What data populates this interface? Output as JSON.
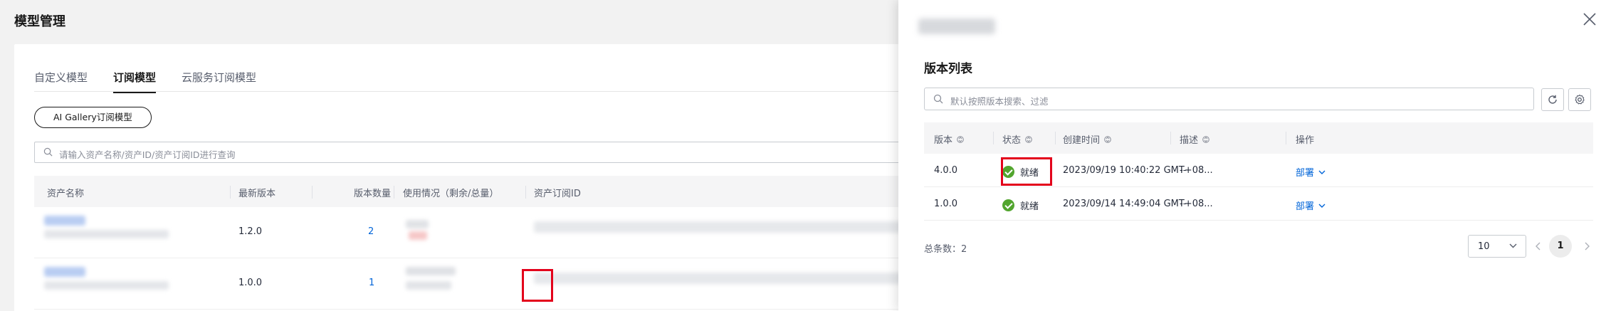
{
  "page": {
    "title": "模型管理"
  },
  "tabs": [
    {
      "label": "自定义模型",
      "active": false
    },
    {
      "label": "订阅模型",
      "active": true
    },
    {
      "label": "云服务订阅模型",
      "active": false
    }
  ],
  "filter_pill": "AI Gallery订阅模型",
  "search": {
    "placeholder": "请输入资产名称/资产ID/资产订阅ID进行查询"
  },
  "asset_table": {
    "columns": [
      "资产名称",
      "最新版本",
      "版本数量",
      "使用情况（剩余/总量）",
      "资产订阅ID"
    ],
    "rows": [
      {
        "latest_version": "1.2.0",
        "version_count": "2"
      },
      {
        "latest_version": "1.0.0",
        "version_count": "1"
      }
    ]
  },
  "panel": {
    "section_title": "版本列表",
    "search_placeholder": "默认按照版本搜索、过滤",
    "columns": [
      "版本",
      "状态",
      "创建时间",
      "描述",
      "操作"
    ],
    "rows": [
      {
        "version": "4.0.0",
        "status": "就绪",
        "created": "2023/09/19 10:40:22 GMT+08...",
        "desc": "--",
        "action": "部署"
      },
      {
        "version": "1.0.0",
        "status": "就绪",
        "created": "2023/09/14 14:49:04 GMT+08...",
        "desc": "--",
        "action": "部署"
      }
    ],
    "total_label": "总条数：2",
    "page_size": "10",
    "current_page": "1"
  },
  "colors": {
    "link": "#0064d8",
    "success": "#52a52e",
    "highlight": "#e3001b"
  },
  "icons": [
    "search-icon",
    "refresh-icon",
    "settings-icon",
    "close-icon",
    "sort-icon",
    "chevron-down-icon",
    "chevron-left-icon",
    "chevron-right-icon",
    "check-circle-icon"
  ]
}
